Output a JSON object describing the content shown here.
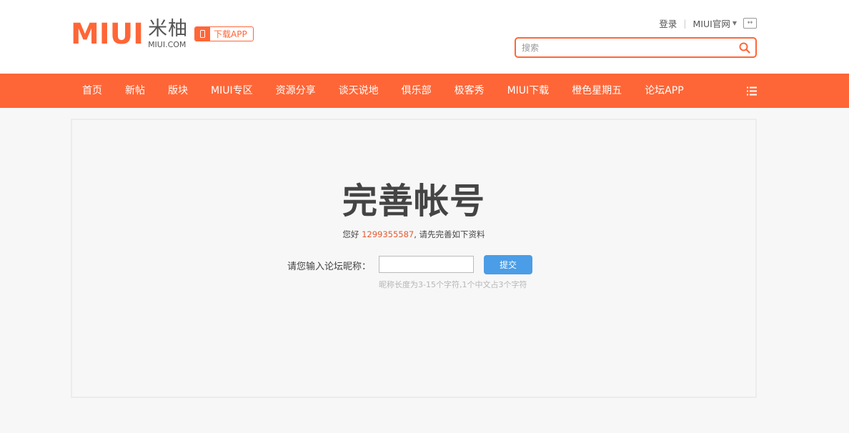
{
  "header": {
    "logo": {
      "brand": "MIUI",
      "cn": "米柚",
      "en": "MIUI.COM"
    },
    "download_app": "下载APP",
    "login": "登录",
    "official_site": "MIUI官网",
    "search": {
      "placeholder": "搜索"
    }
  },
  "nav": {
    "items": [
      {
        "label": "首页"
      },
      {
        "label": "新帖"
      },
      {
        "label": "版块"
      },
      {
        "label": "MIUI专区"
      },
      {
        "label": "资源分享"
      },
      {
        "label": "谈天说地"
      },
      {
        "label": "俱乐部"
      },
      {
        "label": "极客秀"
      },
      {
        "label": "MIUI下载"
      },
      {
        "label": "橙色星期五"
      },
      {
        "label": "论坛APP"
      }
    ]
  },
  "main": {
    "title": "完善帐号",
    "greeting_prefix": "您好",
    "account_number": "1299355587",
    "greeting_suffix": ", 请先完善如下资料",
    "form": {
      "label": "请您输入论坛昵称：",
      "nickname_value": "",
      "submit_label": "提交",
      "hint": "昵称长度为3-15个字符,1个中文占3个字符"
    }
  },
  "colors": {
    "brand_orange": "#ff6637",
    "submit_blue": "#4a9de6",
    "account_number": "#e8592f"
  }
}
